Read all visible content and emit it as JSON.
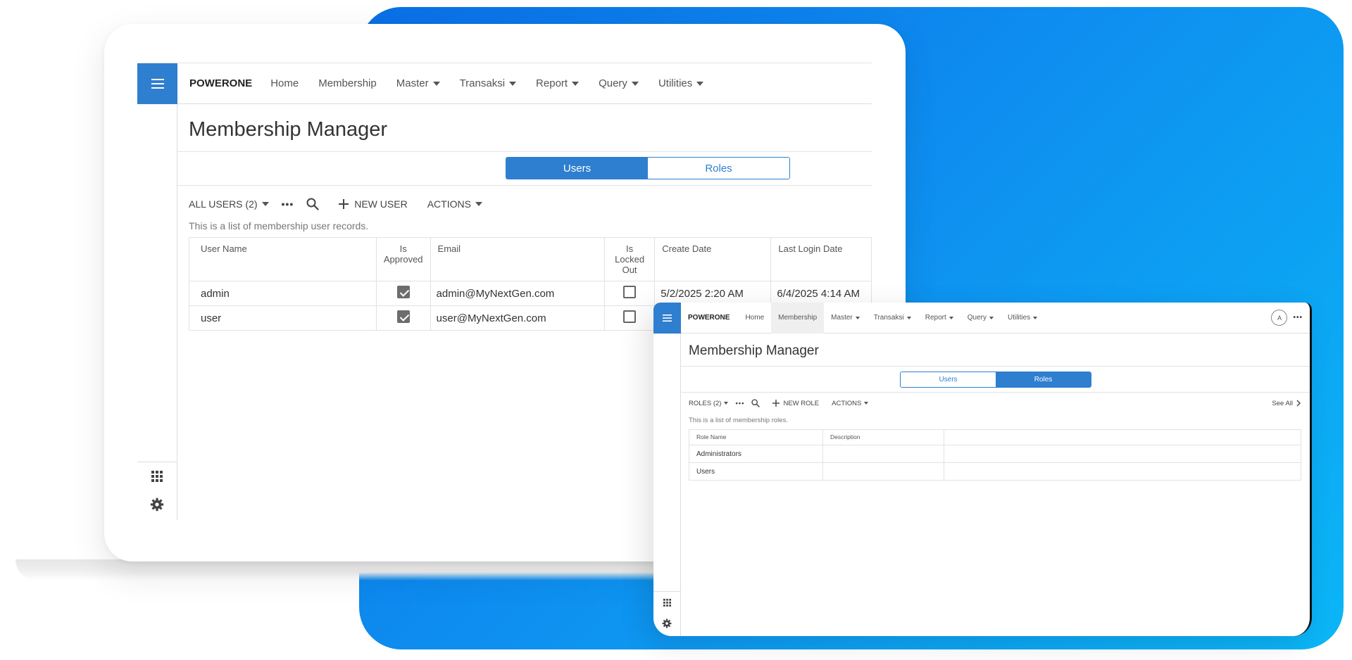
{
  "colors": {
    "accent": "#2e7fd0",
    "background_gradient_start": "#0a6fe6",
    "background_gradient_end": "#0bb6f6"
  },
  "laptop": {
    "nav": {
      "brand": "POWERONE",
      "items": [
        {
          "label": "Home",
          "dropdown": false
        },
        {
          "label": "Membership",
          "dropdown": false
        },
        {
          "label": "Master",
          "dropdown": true
        },
        {
          "label": "Transaksi",
          "dropdown": true
        },
        {
          "label": "Report",
          "dropdown": true
        },
        {
          "label": "Query",
          "dropdown": true
        },
        {
          "label": "Utilities",
          "dropdown": true
        }
      ]
    },
    "title": "Membership Manager",
    "tabs": [
      {
        "label": "Users",
        "active": true
      },
      {
        "label": "Roles",
        "active": false
      }
    ],
    "toolbar": {
      "filter": "ALL USERS (2)",
      "more": "•••",
      "new": "NEW USER",
      "actions": "ACTIONS"
    },
    "description": "This is a list of membership user records.",
    "table": {
      "headers": [
        "User Name",
        "Is Approved",
        "Email",
        "Is Locked Out",
        "Create Date",
        "Last Login Date"
      ],
      "rows": [
        {
          "user_name": "admin",
          "is_approved": true,
          "email": "admin@MyNextGen.com",
          "is_locked_out": false,
          "create_date": "5/2/2025 2:20 AM",
          "last_login": "6/4/2025 4:14 AM"
        },
        {
          "user_name": "user",
          "is_approved": true,
          "email": "user@MyNextGen.com",
          "is_locked_out": false,
          "create_date": "",
          "last_login": ""
        }
      ]
    }
  },
  "tablet": {
    "nav": {
      "brand": "POWERONE",
      "items": [
        {
          "label": "Home",
          "dropdown": false,
          "active": false
        },
        {
          "label": "Membership",
          "dropdown": false,
          "active": true
        },
        {
          "label": "Master",
          "dropdown": true
        },
        {
          "label": "Transaksi",
          "dropdown": true
        },
        {
          "label": "Report",
          "dropdown": true
        },
        {
          "label": "Query",
          "dropdown": true
        },
        {
          "label": "Utilities",
          "dropdown": true
        }
      ],
      "avatar": "A",
      "more": "•••"
    },
    "title": "Membership Manager",
    "tabs": [
      {
        "label": "Users",
        "active": false
      },
      {
        "label": "Roles",
        "active": true
      }
    ],
    "toolbar": {
      "filter": "ROLES (2)",
      "more": "•••",
      "new": "NEW ROLE",
      "actions": "ACTIONS",
      "see_all": "See All"
    },
    "description": "This is a list of membership roles.",
    "table": {
      "headers": [
        "Role Name",
        "Description",
        ""
      ],
      "rows": [
        {
          "role_name": "Administrators",
          "description": ""
        },
        {
          "role_name": "Users",
          "description": ""
        }
      ]
    }
  }
}
